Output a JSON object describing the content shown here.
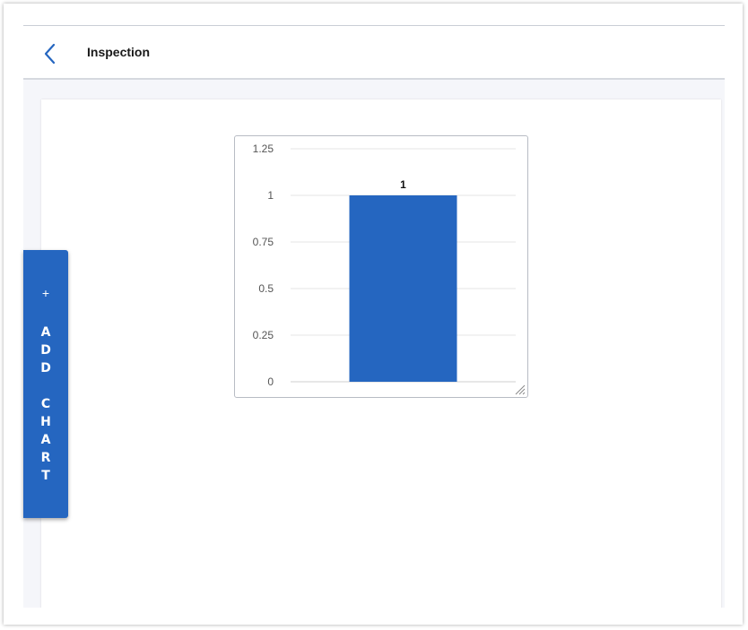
{
  "header": {
    "title": "Inspection",
    "back_icon": "chevron-left-icon"
  },
  "sidebar": {
    "add_chart_icon": "+",
    "add_chart_letters": [
      "A",
      "D",
      "D",
      "",
      "C",
      "H",
      "A",
      "R",
      "T"
    ]
  },
  "colors": {
    "accent": "#2566c0",
    "bar": "#2566c0",
    "grid": "#e6e6e6"
  },
  "chart_data": {
    "type": "bar",
    "categories": [
      ""
    ],
    "values": [
      1
    ],
    "data_labels": [
      "1"
    ],
    "yticks": [
      "1.25",
      "1",
      "0.75",
      "0.5",
      "0.25",
      "0"
    ],
    "ylim": [
      0,
      1.25
    ],
    "grid": true,
    "title": "",
    "xlabel": "",
    "ylabel": ""
  }
}
